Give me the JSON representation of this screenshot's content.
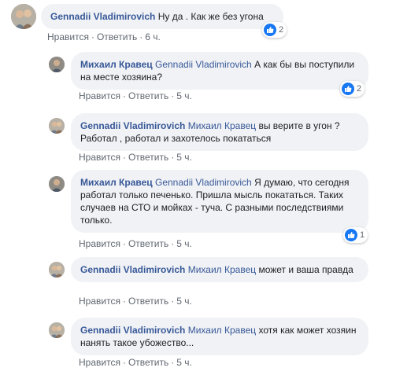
{
  "actions": {
    "like": "Нравится",
    "reply": "Ответить",
    "sep": "·"
  },
  "comments": [
    {
      "author": "Gennadii Vladimirovich",
      "mention": "",
      "text": "Ну да . Как же без угона",
      "time": "6 ч.",
      "reactions": "2"
    },
    {
      "author": "Михаил Кравец",
      "mention": "Gennadii Vladimirovich",
      "text": "А как бы вы поступили на месте хозяина?",
      "time": "5 ч.",
      "reactions": "2"
    },
    {
      "author": "Gennadii Vladimirovich",
      "mention": "Михаил Кравец",
      "text": "вы верите в угон ? Работал , работал и захотелось покататься",
      "time": "5 ч.",
      "reactions": ""
    },
    {
      "author": "Михаил Кравец",
      "mention": "Gennadii Vladimirovich",
      "text": "Я думаю, что сегодня работал только печенько. Пришла мысль покататься. Таких случаев на СТО и мойках - туча. С разными последствиями только.",
      "time": "5 ч.",
      "reactions": "1"
    },
    {
      "author": "Gennadii Vladimirovich",
      "mention": "Михаил Кравец",
      "text": "может и ваша правда",
      "time": "5 ч.",
      "reactions": ""
    },
    {
      "author": "Gennadii Vladimirovich",
      "mention": "Михаил Кравец",
      "text": "хотя как может хозяин нанять такое убожество...",
      "time": "5 ч.",
      "reactions": ""
    }
  ],
  "colors": {
    "link": "#385898",
    "bubble": "#f0f2f5",
    "meta": "#606770",
    "like": "#1877f2"
  }
}
